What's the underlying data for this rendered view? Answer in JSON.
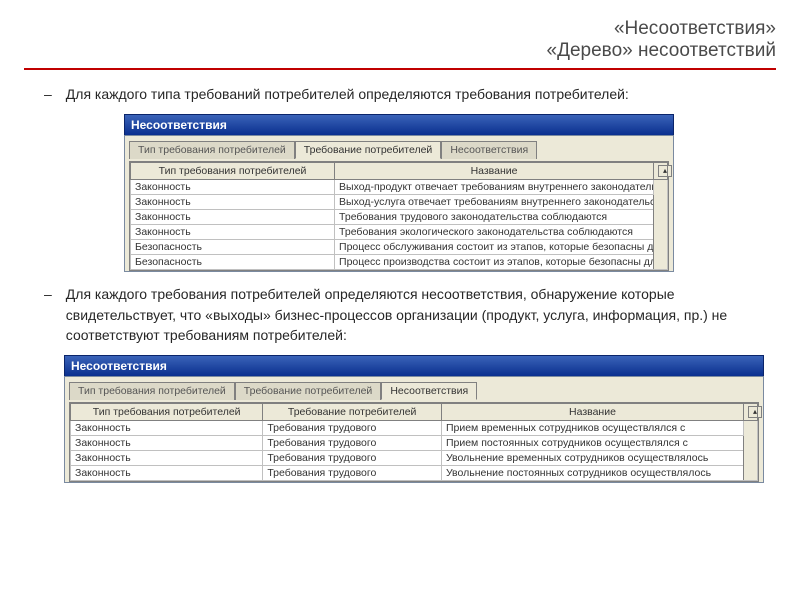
{
  "header": {
    "title1": "«Несоответствия»",
    "title2": "«Дерево» несоответствий"
  },
  "bullet1": "Для каждого типа требований потребителей определяются требования потребителей:",
  "bullet2": "Для каждого требования потребителей определяются несоответствия, обнаружение которые свидетельствует, что «выходы» бизнес-процессов организации (продукт, услуга, информация, пр.) не соответствуют требованиям потребителей:",
  "win": {
    "title": "Несоответствия",
    "tabs": {
      "t1": "Тип требования потребителей",
      "t2": "Требование потребителей",
      "t3": "Несоответствия"
    }
  },
  "grid1": {
    "headers": {
      "c1": "Тип требования потребителей",
      "c2": "Название"
    },
    "rows": [
      {
        "c1": "Законность",
        "c2": "Выход-продукт отвечает требованиям внутреннего законодательства"
      },
      {
        "c1": "Законность",
        "c2": "Выход-услуга отвечает требованиям внутреннего законодательства"
      },
      {
        "c1": "Законность",
        "c2": "Требования трудового законодательства соблюдаются"
      },
      {
        "c1": "Законность",
        "c2": "Требования экологического законодательства соблюдаются"
      },
      {
        "c1": "Безопасность",
        "c2": "Процесс обслуживания состоит из этапов, которые безопасны для его"
      },
      {
        "c1": "Безопасность",
        "c2": "Процесс производства состоит из этапов, которые безопасны для его"
      }
    ]
  },
  "grid2": {
    "headers": {
      "c1": "Тип требования потребителей",
      "c2": "Требование потребителей",
      "c3": "Название"
    },
    "rows": [
      {
        "c1": "Законность",
        "c2": "Требования трудового",
        "c3": "Прием временных сотрудников осуществлялся с"
      },
      {
        "c1": "Законность",
        "c2": "Требования трудового",
        "c3": "Прием постоянных сотрудников осуществлялся с"
      },
      {
        "c1": "Законность",
        "c2": "Требования трудового",
        "c3": "Увольнение временных сотрудников осуществлялось"
      },
      {
        "c1": "Законность",
        "c2": "Требования трудового",
        "c3": "Увольнение постоянных сотрудников осуществлялось"
      }
    ]
  }
}
